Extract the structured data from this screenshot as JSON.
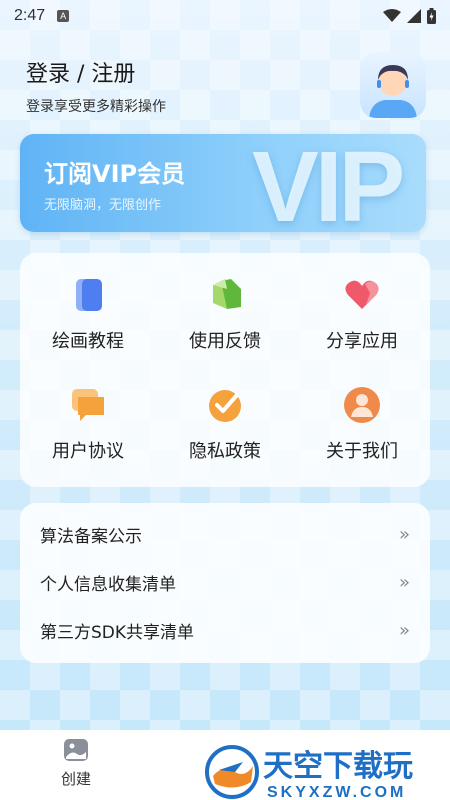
{
  "status_bar": {
    "time": "2:47",
    "notification_icon": "A"
  },
  "header": {
    "login_title": "登录 / 注册",
    "login_subtitle": "登录享受更多精彩操作"
  },
  "vip": {
    "title": "订阅VIP会员",
    "subtitle": "无限脑洞，无限创作",
    "big_text": "VIP"
  },
  "grid": [
    {
      "label": "绘画教程",
      "icon": "book-icon"
    },
    {
      "label": "使用反馈",
      "icon": "feedback-icon"
    },
    {
      "label": "分享应用",
      "icon": "heart-icon"
    },
    {
      "label": "用户协议",
      "icon": "chat-icon"
    },
    {
      "label": "隐私政策",
      "icon": "check-icon"
    },
    {
      "label": "关于我们",
      "icon": "user-icon"
    }
  ],
  "list": [
    {
      "label": "算法备案公示",
      "arrow": "»"
    },
    {
      "label": "个人信息收集清单",
      "arrow": "»"
    },
    {
      "label": "第三方SDK共享清单",
      "arrow": "»"
    }
  ],
  "bottom_nav": {
    "create_label": "创建"
  },
  "watermark": {
    "brand": "天空下载玩",
    "domain": "SKYXZW.COM"
  },
  "colors": {
    "accent": "#5fb3f5",
    "orange": "#f5a23c",
    "red": "#ef5a6a",
    "green": "#8bc34a",
    "blue": "#4f7ef0"
  }
}
